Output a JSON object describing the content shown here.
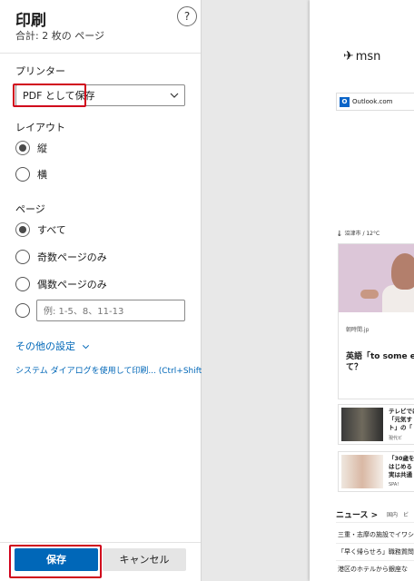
{
  "dialog": {
    "title": "印刷",
    "subtitle": "合計: 2 枚の ページ",
    "help_label": "?"
  },
  "printer": {
    "label": "プリンター",
    "selected": "PDF として保存"
  },
  "layout": {
    "label": "レイアウト",
    "options": [
      {
        "label": "縦",
        "checked": true
      },
      {
        "label": "横",
        "checked": false
      }
    ]
  },
  "pages": {
    "label": "ページ",
    "options": [
      {
        "label": "すべて",
        "checked": true
      },
      {
        "label": "奇数ページのみ",
        "checked": false
      },
      {
        "label": "偶数ページのみ",
        "checked": false
      }
    ],
    "custom_placeholder": "例: 1-5、8、11-13"
  },
  "more_settings": "その他の設定",
  "system_dialog_link": "システム ダイアログを使用して印刷... (Ctrl+Shift+P)",
  "buttons": {
    "save": "保存",
    "cancel": "キャンセル"
  },
  "preview": {
    "logo": "msn",
    "outlook": "Outlook.com",
    "weather": "沼津市 / 12°C",
    "card_source": "朝時間.jp",
    "card_title": "英語「to some ext\nて？",
    "mini1_text": "テレビでは\n「元気す\nト」の「",
    "mini1_source": "現代ビ",
    "mini2_text": "「30歳を\nはじめる\n実は共通",
    "mini2_source": "SPA!",
    "news_heading": "ニュース >",
    "news_tabs": "国内　ビ",
    "news_items": [
      "三重・志摩の施設でイワシ",
      "「早く帰らせろ」職務質問",
      "港区のホテルから銀座な"
    ]
  },
  "colors": {
    "accent": "#0067b8",
    "highlight": "#d0021b"
  }
}
